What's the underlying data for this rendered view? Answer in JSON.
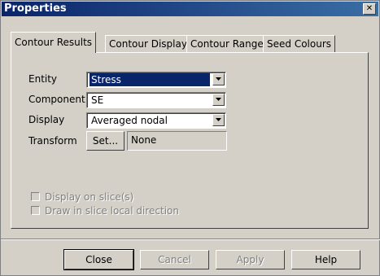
{
  "window": {
    "title": "Properties",
    "close_icon": "close-icon"
  },
  "tabs": [
    {
      "label": "Contour Results",
      "active": true
    },
    {
      "label": "Contour Display",
      "active": false
    },
    {
      "label": "Contour Range",
      "active": false
    },
    {
      "label": "Seed Colours",
      "active": false
    }
  ],
  "form": {
    "entity_label": "Entity",
    "entity_value": "Stress",
    "component_label": "Component",
    "component_value": "SE",
    "display_label": "Display",
    "display_value": "Averaged nodal",
    "transform_label": "Transform",
    "transform_button": "Set...",
    "transform_value": "None"
  },
  "options": {
    "display_on_slice_label": "Display on slice(s)",
    "display_on_slice_checked": false,
    "draw_in_slice_label": "Draw in slice local direction",
    "draw_in_slice_checked": false
  },
  "buttons": {
    "close": "Close",
    "cancel": "Cancel",
    "apply": "Apply",
    "help": "Help"
  },
  "colors": {
    "titlebar_start": "#0a246a",
    "titlebar_end": "#3a6ea5",
    "selection": "#0a246a",
    "dialog_bg": "#d4d0c8"
  }
}
